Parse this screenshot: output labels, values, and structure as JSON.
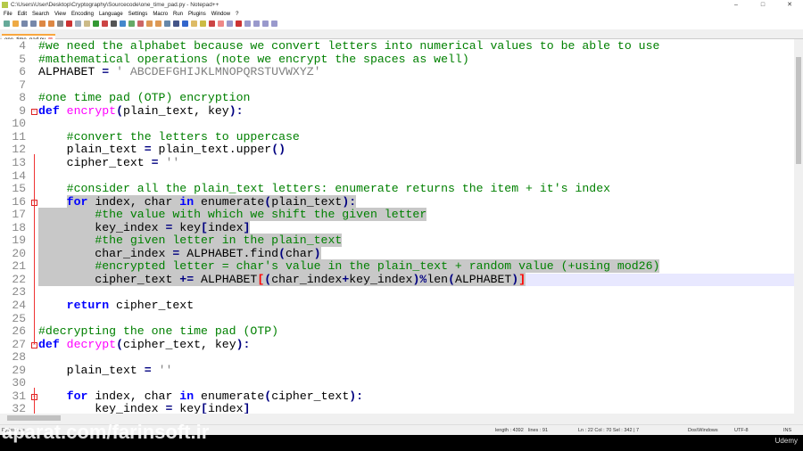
{
  "window": {
    "title": "C:\\Users\\User\\Desktop\\Cryptography\\Sourcecode\\one_time_pad.py - Notepad++",
    "controls": [
      "–",
      "□",
      "✕"
    ]
  },
  "menu": [
    "File",
    "Edit",
    "Search",
    "View",
    "Encoding",
    "Language",
    "Settings",
    "Macro",
    "Run",
    "Plugins",
    "Window",
    "?"
  ],
  "tab": {
    "label": "one_time_pad.py",
    "close": "⊠"
  },
  "colors": {
    "keyword": "#0000ff",
    "comment": "#008000",
    "string": "#808080",
    "function": "#ff00ff",
    "selection": "#c8c8c8",
    "current_line": "#e8e8ff",
    "tab_accent": "#f9a73e"
  },
  "editor": {
    "lines": [
      {
        "n": 4,
        "t": [
          [
            "cm",
            "#we need the alphabet because we convert letters into numerical values to be able to use"
          ]
        ]
      },
      {
        "n": 5,
        "t": [
          [
            "cm",
            "#mathematical operations (note we encrypt the spaces as well)"
          ]
        ]
      },
      {
        "n": 6,
        "t": [
          [
            "",
            "ALPHABET "
          ],
          [
            "op",
            "="
          ],
          [
            "",
            ""
          ],
          [
            "st",
            " ' ABCDEFGHIJKLMNOPQRSTUVWXYZ'"
          ]
        ]
      },
      {
        "n": 7,
        "t": []
      },
      {
        "n": 8,
        "t": [
          [
            "cm",
            "#one time pad (OTP) encryption"
          ]
        ]
      },
      {
        "n": 9,
        "fold": true,
        "t": [
          [
            "kw",
            "def"
          ],
          [
            "",
            " "
          ],
          [
            "fn",
            "encrypt"
          ],
          [
            "op",
            "("
          ],
          [
            "",
            "plain_text, key"
          ],
          [
            "op",
            "):"
          ]
        ]
      },
      {
        "n": 10,
        "t": []
      },
      {
        "n": 11,
        "t": [
          [
            "",
            "    "
          ],
          [
            "cm",
            "#convert the letters to uppercase"
          ]
        ]
      },
      {
        "n": 12,
        "t": [
          [
            "",
            "    plain_text "
          ],
          [
            "op",
            "="
          ],
          [
            "",
            " plain_text.upper"
          ],
          [
            "op",
            "()"
          ]
        ]
      },
      {
        "n": 13,
        "t": [
          [
            "",
            "    cipher_text "
          ],
          [
            "op",
            "="
          ],
          [
            "",
            " "
          ],
          [
            "st",
            "''"
          ]
        ]
      },
      {
        "n": 14,
        "t": []
      },
      {
        "n": 15,
        "t": [
          [
            "",
            "    "
          ],
          [
            "cm",
            "#consider all the plain_text letters: enumerate returns the item + it's index"
          ]
        ]
      },
      {
        "n": 16,
        "fold": true,
        "sel": 4,
        "t": [
          [
            "",
            "    "
          ],
          [
            "kw",
            "for"
          ],
          [
            "",
            " index, char "
          ],
          [
            "kw",
            "in"
          ],
          [
            "",
            " enumerate"
          ],
          [
            "op",
            "("
          ],
          [
            "",
            "plain_text"
          ],
          [
            "op",
            "):"
          ]
        ]
      },
      {
        "n": 17,
        "sel": 0,
        "t": [
          [
            "",
            "        "
          ],
          [
            "cm",
            "#the value with which we shift the given letter"
          ]
        ]
      },
      {
        "n": 18,
        "sel": 0,
        "t": [
          [
            "",
            "        key_index "
          ],
          [
            "op",
            "="
          ],
          [
            "",
            " key"
          ],
          [
            "op",
            "["
          ],
          [
            "",
            "index"
          ],
          [
            "op",
            "]"
          ]
        ]
      },
      {
        "n": 19,
        "sel": 0,
        "t": [
          [
            "",
            "        "
          ],
          [
            "cm",
            "#the given letter in the plain_text"
          ]
        ]
      },
      {
        "n": 20,
        "sel": 0,
        "t": [
          [
            "",
            "        char_index "
          ],
          [
            "op",
            "="
          ],
          [
            "",
            " ALPHABET.find"
          ],
          [
            "op",
            "("
          ],
          [
            "",
            "char"
          ],
          [
            "op",
            ")"
          ]
        ]
      },
      {
        "n": 21,
        "sel": 0,
        "t": [
          [
            "",
            "        "
          ],
          [
            "cm",
            "#encrypted letter = char's value in the plain_text + random value (+using mod26)"
          ]
        ]
      },
      {
        "n": 22,
        "sel": 0,
        "cur": true,
        "t": [
          [
            "",
            "        cipher_text "
          ],
          [
            "op",
            "+="
          ],
          [
            "",
            " ALPHABET"
          ],
          [
            "br",
            "["
          ],
          [
            "op",
            "("
          ],
          [
            "",
            "char_index"
          ],
          [
            "op",
            "+"
          ],
          [
            "",
            "key_index"
          ],
          [
            "op",
            ")%"
          ],
          [
            "",
            "len"
          ],
          [
            "op",
            "("
          ],
          [
            "",
            "ALPHABET"
          ],
          [
            "op",
            ")"
          ],
          [
            "br",
            "]"
          ]
        ]
      },
      {
        "n": 23,
        "t": []
      },
      {
        "n": 24,
        "t": [
          [
            "",
            "    "
          ],
          [
            "kw",
            "return"
          ],
          [
            "",
            " cipher_text"
          ]
        ]
      },
      {
        "n": 25,
        "t": []
      },
      {
        "n": 26,
        "t": [
          [
            "cm",
            "#decrypting the one time pad (OTP)"
          ]
        ]
      },
      {
        "n": 27,
        "fold": true,
        "t": [
          [
            "kw",
            "def"
          ],
          [
            "",
            " "
          ],
          [
            "fn",
            "decrypt"
          ],
          [
            "op",
            "("
          ],
          [
            "",
            "cipher_text, key"
          ],
          [
            "op",
            "):"
          ]
        ]
      },
      {
        "n": 28,
        "t": []
      },
      {
        "n": 29,
        "t": [
          [
            "",
            "    plain_text "
          ],
          [
            "op",
            "="
          ],
          [
            "",
            " "
          ],
          [
            "st",
            "''"
          ]
        ]
      },
      {
        "n": 30,
        "t": []
      },
      {
        "n": 31,
        "fold": true,
        "t": [
          [
            "",
            "    "
          ],
          [
            "kw",
            "for"
          ],
          [
            "",
            " index, char "
          ],
          [
            "kw",
            "in"
          ],
          [
            "",
            " enumerate"
          ],
          [
            "op",
            "("
          ],
          [
            "",
            "cipher_text"
          ],
          [
            "op",
            "):"
          ]
        ]
      },
      {
        "n": 32,
        "t": [
          [
            "",
            "        key_index "
          ],
          [
            "op",
            "="
          ],
          [
            "",
            " key"
          ],
          [
            "op",
            "["
          ],
          [
            "",
            "index"
          ],
          [
            "op",
            "]"
          ]
        ]
      }
    ]
  },
  "status": {
    "type": "Python file",
    "length": "length : 4392",
    "lines": "lines : 91",
    "pos": "Ln : 22    Col : 70    Sel : 342 | 7",
    "eol": "Dos\\Windows",
    "encoding": "UTF-8",
    "mode": "INS"
  },
  "watermark": "aparat.com/farinsoft.ir",
  "brand": "Udemy"
}
